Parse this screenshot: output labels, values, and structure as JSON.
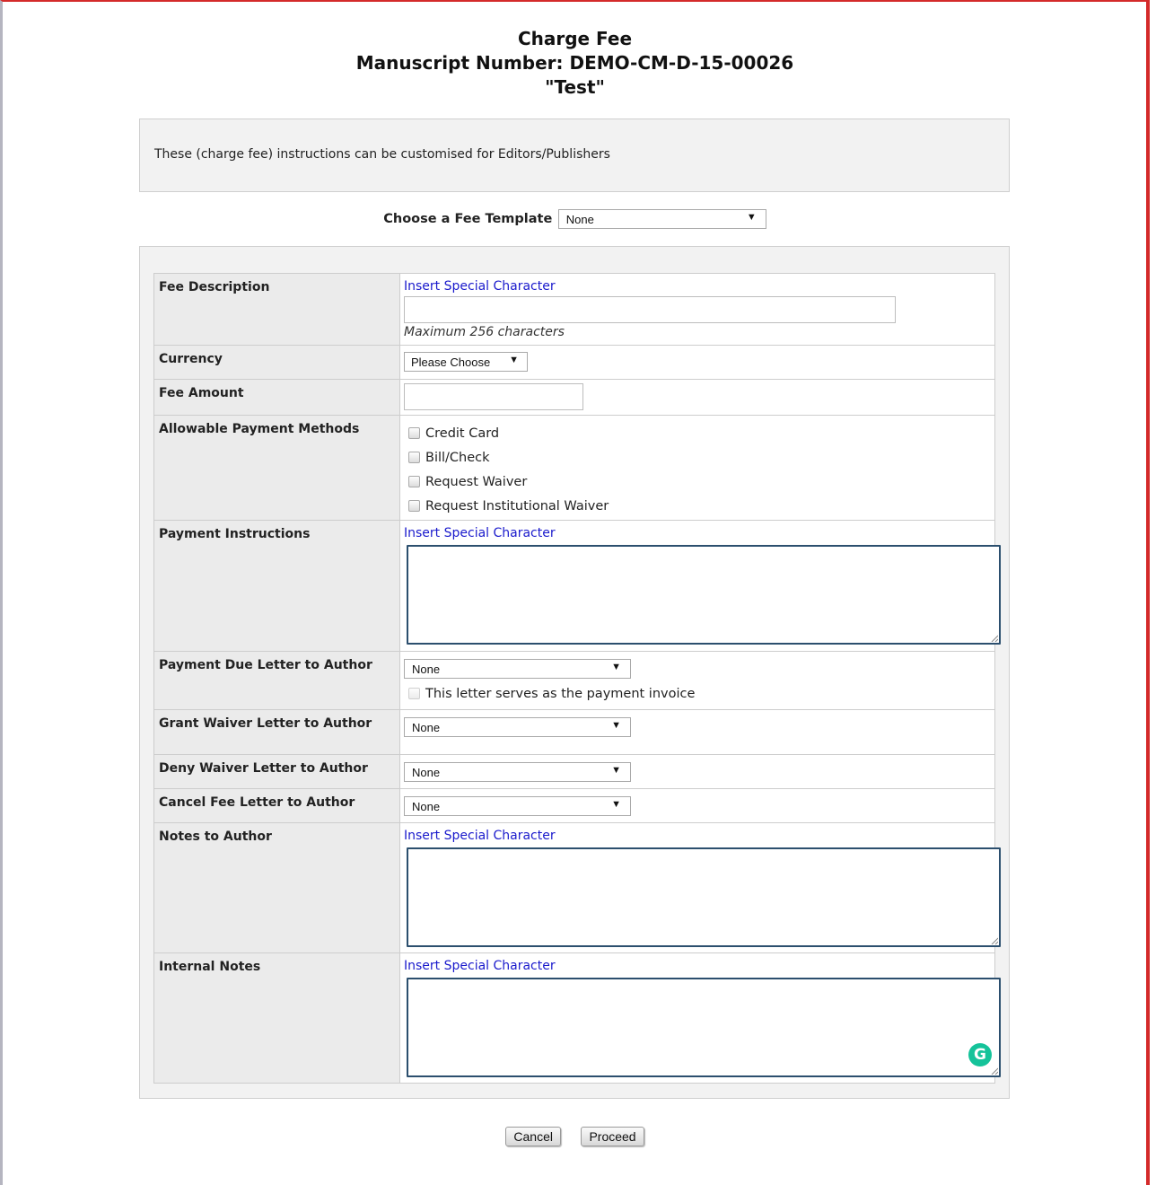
{
  "header": {
    "title": "Charge Fee",
    "manuscript": "Manuscript Number: DEMO-CM-D-15-00026",
    "article_title": "\"Test\""
  },
  "instructions": "These (charge fee) instructions can be customised for Editors/Publishers",
  "fee_template": {
    "label": "Choose a Fee Template",
    "value": "None"
  },
  "form": {
    "fee_description": {
      "label": "Fee Description",
      "link": "Insert Special Character",
      "value": "",
      "hint": "Maximum 256 characters"
    },
    "currency": {
      "label": "Currency",
      "value": "Please Choose"
    },
    "fee_amount": {
      "label": "Fee Amount",
      "value": ""
    },
    "payment_methods": {
      "label": "Allowable Payment Methods",
      "options": [
        "Credit Card",
        "Bill/Check",
        "Request Waiver",
        "Request Institutional Waiver"
      ]
    },
    "payment_instructions": {
      "label": "Payment Instructions",
      "link": "Insert Special Character",
      "value": ""
    },
    "payment_due_letter": {
      "label": "Payment Due Letter to Author",
      "value": "None",
      "invoice_checkbox": "This letter serves as the payment invoice"
    },
    "grant_waiver_letter": {
      "label": "Grant Waiver Letter to Author",
      "value": "None"
    },
    "deny_waiver_letter": {
      "label": "Deny Waiver Letter to Author",
      "value": "None"
    },
    "cancel_fee_letter": {
      "label": "Cancel Fee Letter to Author",
      "value": "None"
    },
    "notes_to_author": {
      "label": "Notes to Author",
      "link": "Insert Special Character",
      "value": ""
    },
    "internal_notes": {
      "label": "Internal Notes",
      "link": "Insert Special Character",
      "value": ""
    }
  },
  "buttons": {
    "cancel": "Cancel",
    "proceed": "Proceed"
  },
  "icons": {
    "grammarly": "grammarly-icon",
    "dropdown": "chevron-down-icon"
  },
  "colors": {
    "link": "#1a1acc",
    "frame": "#d42a2a",
    "textarea_border": "#2c4f6e",
    "grammarly": "#15c39a"
  }
}
